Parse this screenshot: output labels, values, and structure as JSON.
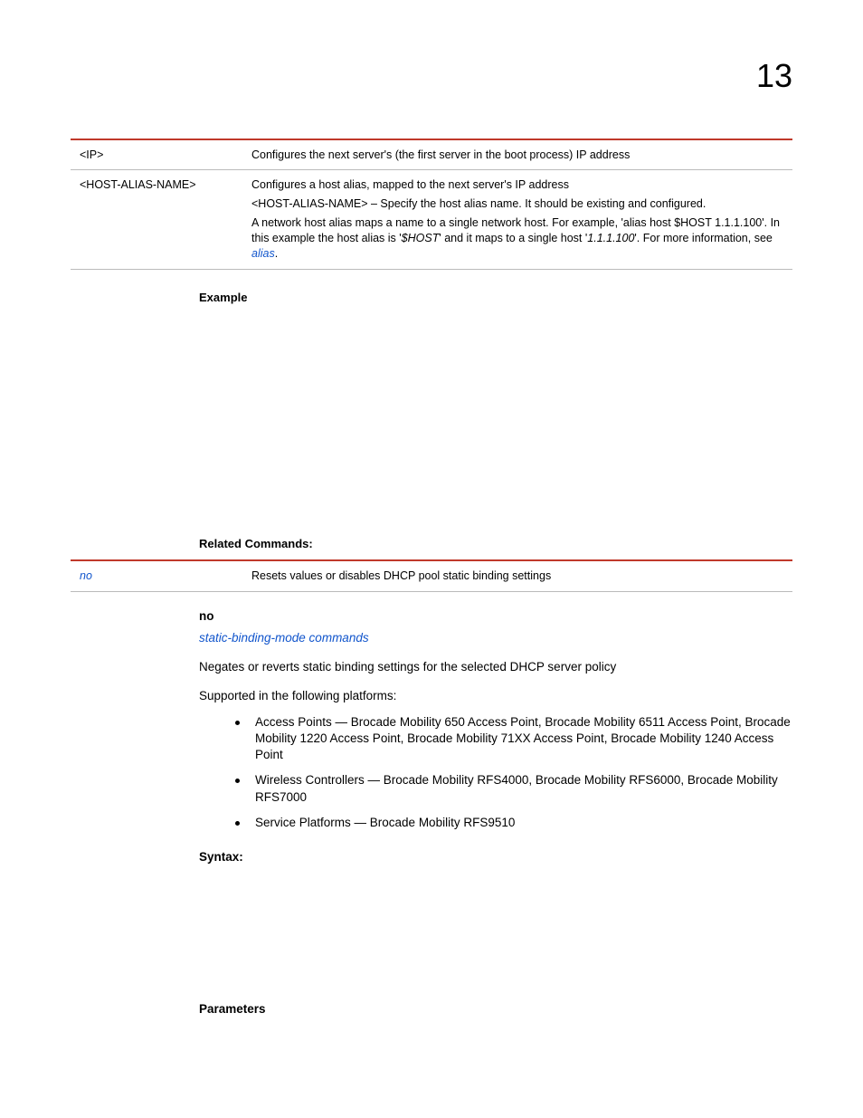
{
  "page_number": "13",
  "table1": {
    "rows": [
      {
        "param": "<IP>",
        "desc": "Configures the next server's (the first server in the boot process) IP address"
      },
      {
        "param": "<HOST-ALIAS-NAME>",
        "desc_line1": "Configures a host alias, mapped to the next server's IP address",
        "bullet": "<HOST-ALIAS-NAME> – Specify the host alias name. It should be existing and configured.",
        "desc_line2a": "A network host alias maps a name to a single network host. For example, 'alias host $HOST 1.1.1.100'. In this example the host alias is '",
        "desc_line2_em": "$HOST",
        "desc_line2b": "' and it maps to a single host '",
        "desc_line2_em2": "1.1.1.100",
        "desc_line2c": "'. For more information, see ",
        "desc_line2_link": "alias",
        "desc_line2d": "."
      }
    ]
  },
  "labels": {
    "example": "Example",
    "related": "Related Commands:",
    "syntax": "Syntax:",
    "parameters": "Parameters"
  },
  "related_table": {
    "cmd": "no",
    "desc": "Resets values or disables DHCP pool static binding settings"
  },
  "no_section": {
    "heading": "no",
    "link": "static-binding-mode commands",
    "desc": "Negates or reverts static binding settings for the selected DHCP server policy",
    "supported": "Supported in the following platforms:",
    "platforms": [
      "Access Points — Brocade Mobility 650 Access Point, Brocade Mobility 6511 Access Point, Brocade Mobility 1220 Access Point, Brocade Mobility 71XX Access Point, Brocade Mobility 1240 Access Point",
      "Wireless Controllers — Brocade Mobility RFS4000, Brocade Mobility RFS6000, Brocade Mobility RFS7000",
      "Service Platforms — Brocade Mobility RFS9510"
    ]
  }
}
